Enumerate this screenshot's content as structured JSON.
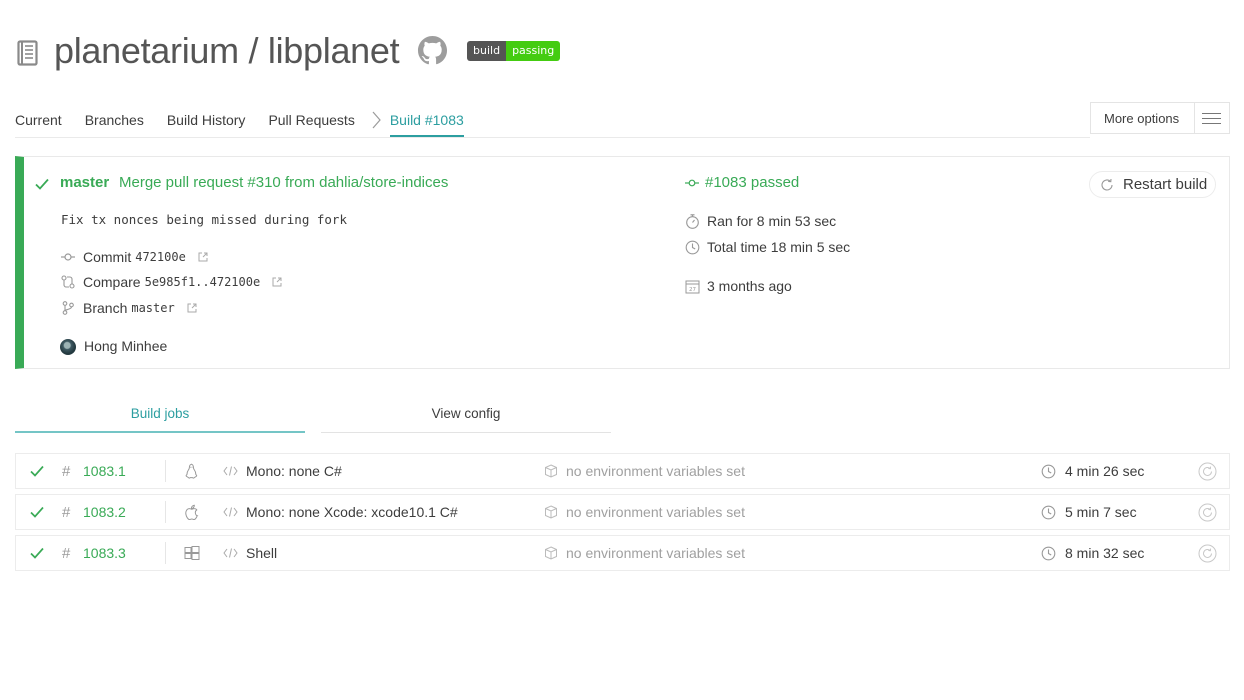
{
  "header": {
    "repo_title": "planetarium / libplanet",
    "badge_left": "build",
    "badge_right": "passing"
  },
  "nav": {
    "tabs": [
      "Current",
      "Branches",
      "Build History",
      "Pull Requests"
    ],
    "active_tab": "Build #1083",
    "more_options": "More options"
  },
  "build": {
    "branch": "master",
    "message": "Merge pull request #310 from dahlia/store-indices",
    "description": "Fix tx nonces being missed during fork",
    "commit_label": "Commit",
    "commit": "472100e",
    "compare_label": "Compare",
    "compare": "5e985f1..472100e",
    "branch_label": "Branch",
    "branch_name": "master",
    "author": "Hong Minhee",
    "state": "#1083 passed",
    "ran_for": "Ran for 8 min 53 sec",
    "total_time": "Total time 18 min 5 sec",
    "finished": "3 months ago",
    "restart_label": "Restart build",
    "status_color": "#39aa56"
  },
  "subtabs": {
    "jobs": "Build jobs",
    "config": "View config"
  },
  "jobs": [
    {
      "number": "1083.1",
      "os": "linux-icon",
      "language": "Mono: none C#",
      "env": "no environment variables set",
      "duration": "4 min 26 sec"
    },
    {
      "number": "1083.2",
      "os": "apple-icon",
      "language": "Mono: none Xcode: xcode10.1 C#",
      "env": "no environment variables set",
      "duration": "5 min 7 sec"
    },
    {
      "number": "1083.3",
      "os": "windows-icon",
      "language": "Shell",
      "env": "no environment variables set",
      "duration": "8 min 32 sec"
    }
  ],
  "colors": {
    "passed": "#39aa56",
    "accent": "#2c9ea0"
  }
}
